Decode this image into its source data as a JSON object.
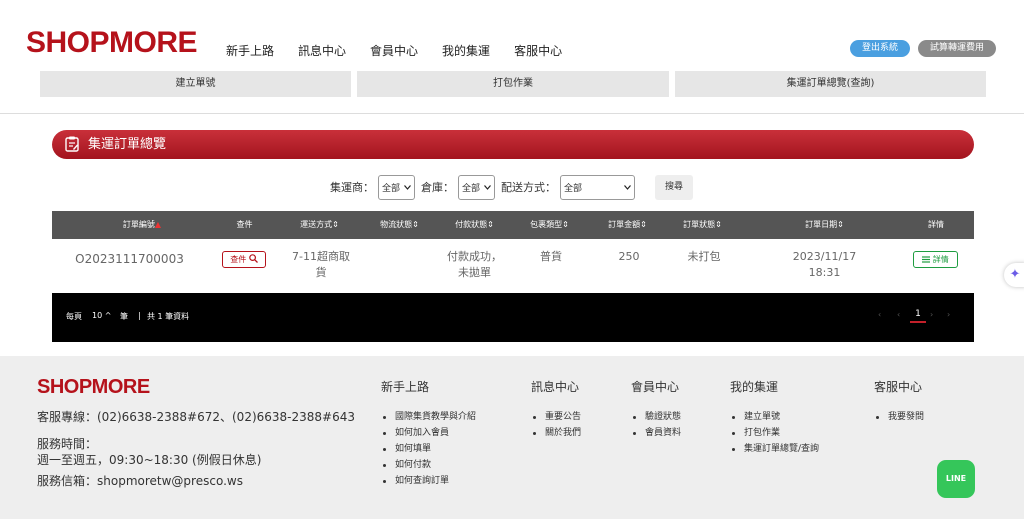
{
  "header": {
    "logo": "SHOPMORE",
    "nav": [
      "新手上路",
      "訊息中心",
      "會員中心",
      "我的集運",
      "客服中心"
    ],
    "login_button": "登出系統",
    "calc_button": "試算轉運費用",
    "subnav": [
      "建立單號",
      "打包作業",
      "集運訂單總覽(查詢)"
    ]
  },
  "main": {
    "title": "集運訂單總覽",
    "filters": {
      "agent_label": "集運商：",
      "agent_value": "全部",
      "warehouse_label": "倉庫：",
      "warehouse_value": "全部",
      "delivery_label": "配送方式：",
      "delivery_value": "全部",
      "search_button": "搜尋"
    },
    "table": {
      "columns": [
        "訂單編號",
        "查件",
        "運送方式",
        "物流狀態",
        "付款狀態",
        "包裹類型",
        "訂單金額",
        "訂單狀態",
        "訂單日期",
        "詳情"
      ],
      "row": {
        "order_no": "O2023111700003",
        "check_button": "查件",
        "shipping_1": "7-11超商取",
        "shipping_2": "貨",
        "logistics": "",
        "payment_1": "付款成功，",
        "payment_2": "未拋單",
        "package_type": "普貨",
        "amount": "250",
        "order_status": "未打包",
        "date": "2023/11/17",
        "time": "18:31",
        "detail_button": "詳情"
      }
    },
    "pager": {
      "per_page_label": "每頁",
      "per_page_value": "10",
      "unit": "筆",
      "total": "共 1 筆資料",
      "current_page": "1"
    }
  },
  "footer": {
    "logo": "SHOPMORE",
    "hotline": "客服專線：(02)6638-2388#672、(02)6638-2388#643",
    "hours_label": "服務時間：",
    "hours_value": "週一至週五，09:30~18:30 (例假日休息)",
    "email": "服務信箱：shopmoretw@presco.ws",
    "columns": [
      {
        "title": "新手上路",
        "items": [
          "國際集貨教學與介紹",
          "如何加入會員",
          "如何填單",
          "如何付款",
          "如何查詢訂單"
        ]
      },
      {
        "title": "訊息中心",
        "items": [
          "重要公告",
          "關於我們"
        ]
      },
      {
        "title": "會員中心",
        "items": [
          "驗證狀態",
          "會員資料"
        ]
      },
      {
        "title": "我的集運",
        "items": [
          "建立單號",
          "打包作業",
          "集運訂單總覽/查詢"
        ]
      },
      {
        "title": "客服中心",
        "items": [
          "我要發問"
        ]
      }
    ],
    "line_label": "LINE"
  },
  "colors": {
    "brand": "#b5121b",
    "login": "#4a9fe0",
    "line": "#35c65a",
    "detail": "#1e9c40"
  }
}
